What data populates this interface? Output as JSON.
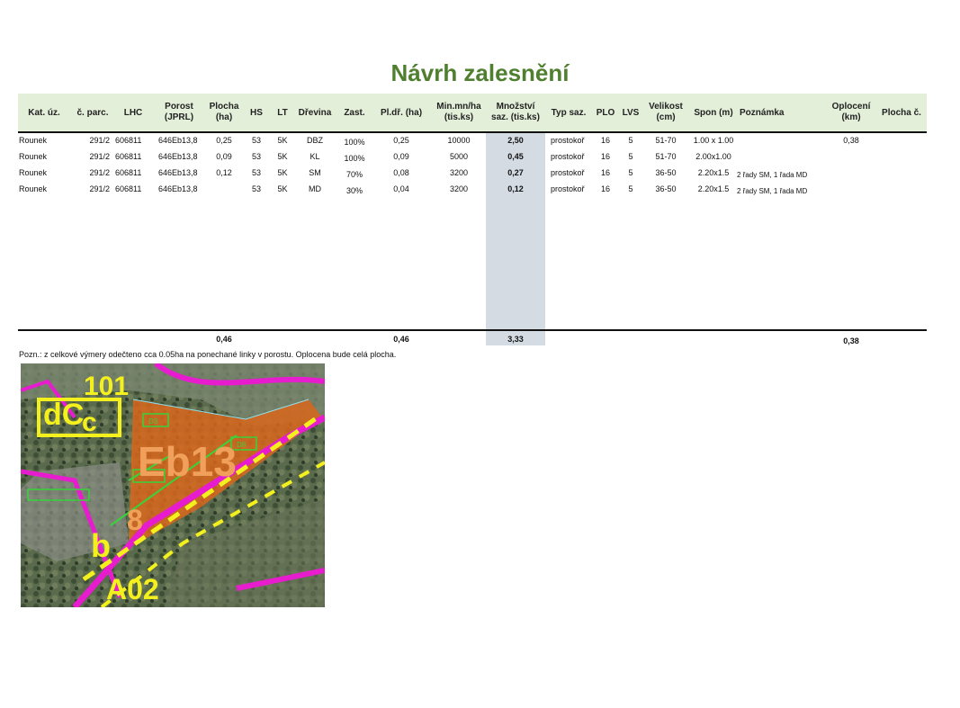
{
  "title": "Návrh zalesnění",
  "columns": {
    "kat_uz": "Kat. úz.",
    "c_parc": "č. parc.",
    "lhc": "LHC",
    "porost_1": "Porost",
    "porost_2": "(JPRL)",
    "plocha_1": "Plocha",
    "plocha_2": "(ha)",
    "hs": "HS",
    "lt": "LT",
    "drevina": "Dřevina",
    "zast": "Zast.",
    "pldr": "Pl.dř. (ha)",
    "minmn_1": "Min.mn/ha",
    "minmn_2": "(tis.ks)",
    "mnozstvi_1": "Množství",
    "mnozstvi_2": "saz. (tis.ks)",
    "typ_saz": "Typ saz.",
    "plo": "PLO",
    "lvs": "LVS",
    "velikost_1": "Velikost",
    "velikost_2": "(cm)",
    "spon": "Spon (m)",
    "poznamka": "Poznámka",
    "oploceni_1": "Oplocení",
    "oploceni_2": "(km)",
    "plocha_c": "Plocha č."
  },
  "rows": [
    {
      "kat_uz": "Rounek",
      "c_parc": "291/2",
      "lhc": "606811",
      "porost": "646Eb13,8",
      "plocha": "0,25",
      "hs": "53",
      "lt": "5K",
      "drevina": "DBZ",
      "zast": "100%",
      "pldr": "0,25",
      "minmn": "10000",
      "mnozstvi": "2,50",
      "typ_saz": "prostokoř",
      "plo": "16",
      "lvs": "5",
      "velikost": "51-70",
      "spon": "1.00 x 1.00",
      "poznamka": "",
      "oploceni": "0,38"
    },
    {
      "kat_uz": "Rounek",
      "c_parc": "291/2",
      "lhc": "606811",
      "porost": "646Eb13,8",
      "plocha": "0,09",
      "hs": "53",
      "lt": "5K",
      "drevina": "KL",
      "zast": "100%",
      "pldr": "0,09",
      "minmn": "5000",
      "mnozstvi": "0,45",
      "typ_saz": "prostokoř",
      "plo": "16",
      "lvs": "5",
      "velikost": "51-70",
      "spon": "2.00x1.00",
      "poznamka": "",
      "oploceni": ""
    },
    {
      "kat_uz": "Rounek",
      "c_parc": "291/2",
      "lhc": "606811",
      "porost": "646Eb13,8",
      "plocha": "0,12",
      "hs": "53",
      "lt": "5K",
      "drevina": "SM",
      "zast": "70%",
      "pldr": "0,08",
      "minmn": "3200",
      "mnozstvi": "0,27",
      "typ_saz": "prostokoř",
      "plo": "16",
      "lvs": "5",
      "velikost": "36-50",
      "spon": "2.20x1.5",
      "poznamka": "2 řady SM, 1 řada MD",
      "oploceni": ""
    },
    {
      "kat_uz": "Rounek",
      "c_parc": "291/2",
      "lhc": "606811",
      "porost": "646Eb13,8",
      "plocha": "",
      "hs": "53",
      "lt": "5K",
      "drevina": "MD",
      "zast": "30%",
      "pldr": "0,04",
      "minmn": "3200",
      "mnozstvi": "0,12",
      "typ_saz": "prostokoř",
      "plo": "16",
      "lvs": "5",
      "velikost": "36-50",
      "spon": "2.20x1.5",
      "poznamka": "2 řady SM, 1 řada MD",
      "oploceni": ""
    }
  ],
  "totals": {
    "plocha": "0,46",
    "pldr": "0,46",
    "mnozstvi": "3,33",
    "oploceni": "0,38"
  },
  "note": "Pozn.: z celkové výmery odečteno cca 0.05ha na ponechané linky v porostu. Oplocena bude celá plocha.",
  "map": {
    "labels": {
      "l101": "101",
      "dc": "dC",
      "c": "c",
      "eb13": "Eb13",
      "eight": "8",
      "b": "b",
      "a02": "A02",
      "d3": "D3",
      "d8": "D8"
    }
  },
  "colors": {
    "title": "#4f7f2f",
    "header_bg": "#e3efd9",
    "quantity_bg": "#d4dbe3",
    "map_magenta": "#e81ccf",
    "map_yellow": "#f3f01e",
    "map_orange": "#d9661c",
    "map_green_line": "#37d43a"
  }
}
